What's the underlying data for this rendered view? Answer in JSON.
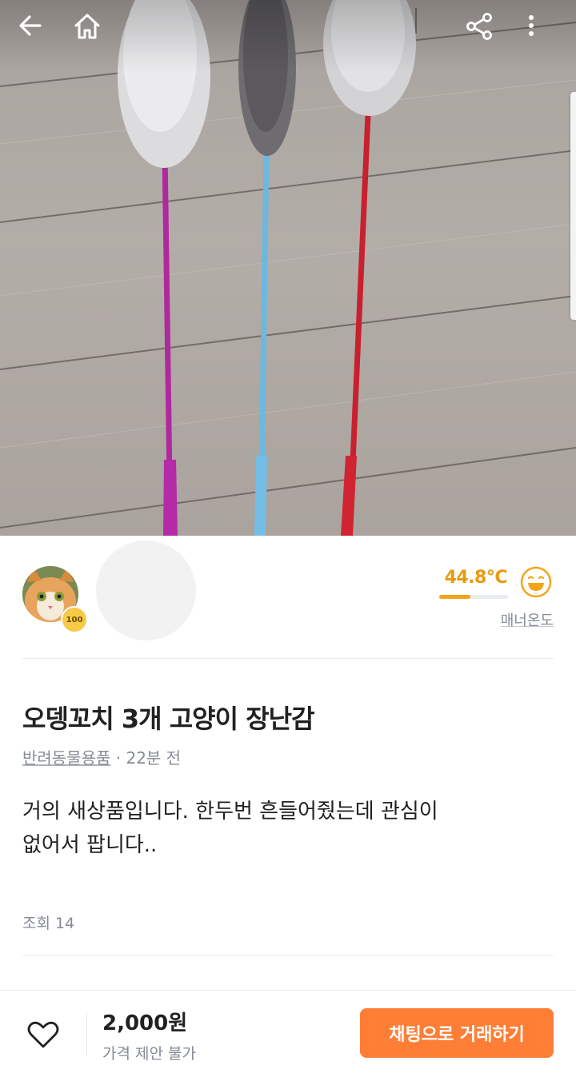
{
  "header": {
    "back_icon": "arrow-left-icon",
    "home_icon": "home-icon",
    "share_icon": "share-icon",
    "more_icon": "more-vertical-icon"
  },
  "seller": {
    "avatar_icon": "cat-avatar",
    "badge_text": "100",
    "temperature": "44.8°C",
    "temperature_level": 0.448,
    "manner_label": "매너온도",
    "accent_color": "#e89a10"
  },
  "article": {
    "title": "오뎅꼬치 3개 고양이 장난감",
    "category": "반려동물용품",
    "time": " · 22분 전",
    "body_line1": "거의 새상품입니다. 한두번 흔들어줬는데 관심이",
    "body_line2": "없어서 팝니다..",
    "views": "조회 14"
  },
  "bottom": {
    "price": "2,000원",
    "price_note": "가격 제안 불가",
    "chat_button": "채팅으로 거래하기",
    "button_color": "#ff7e36"
  }
}
